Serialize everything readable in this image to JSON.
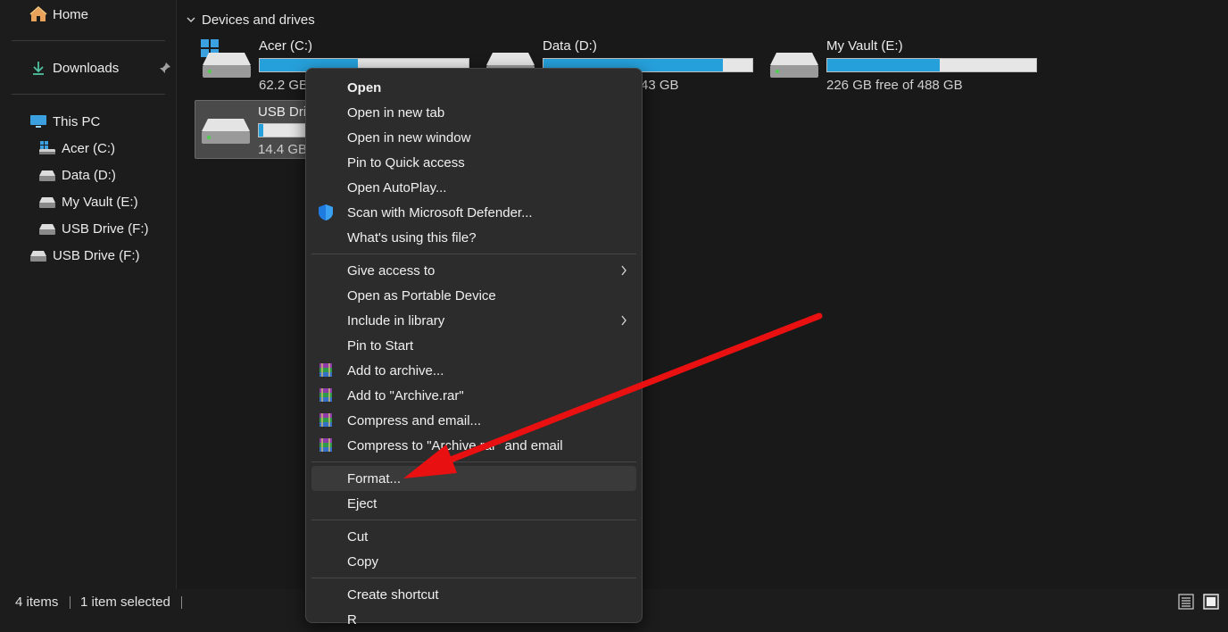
{
  "sidebar": {
    "home": "Home",
    "downloads": "Downloads",
    "this_pc": "This PC",
    "tree": [
      "Acer (C:)",
      "Data (D:)",
      "My Vault (E:)",
      "USB Drive (F:)"
    ],
    "usb_root": "USB Drive (F:)"
  },
  "section": {
    "title": "Devices and drives"
  },
  "drives": [
    {
      "name": "Acer (C:)",
      "free": "62.2 GB",
      "used_fraction": 0.47
    },
    {
      "name": "Data (D:)",
      "free": "43 GB",
      "used_fraction": 0.86
    },
    {
      "name": "My Vault (E:)",
      "free": "226 GB free of 488 GB",
      "used_fraction": 0.54
    },
    {
      "name": "USB Driv",
      "free": "14.4 GB",
      "used_fraction": 0.02
    }
  ],
  "menu": {
    "items": [
      "Open",
      "Open in new tab",
      "Open in new window",
      "Pin to Quick access",
      "Open AutoPlay...",
      "Scan with Microsoft Defender...",
      "What's using this file?",
      "Give access to",
      "Open as Portable Device",
      "Include in library",
      "Pin to Start",
      "Add to archive...",
      "Add to \"Archive.rar\"",
      "Compress and email...",
      "Compress to \"Archive.rar\" and email",
      "Format...",
      "Eject",
      "Cut",
      "Copy",
      "Create shortcut",
      "R"
    ]
  },
  "status": {
    "items": "4 items",
    "selected": "1 item selected"
  },
  "colors": {
    "accent": "#26a0da",
    "arrow": "#e81010",
    "background": "#191919"
  }
}
